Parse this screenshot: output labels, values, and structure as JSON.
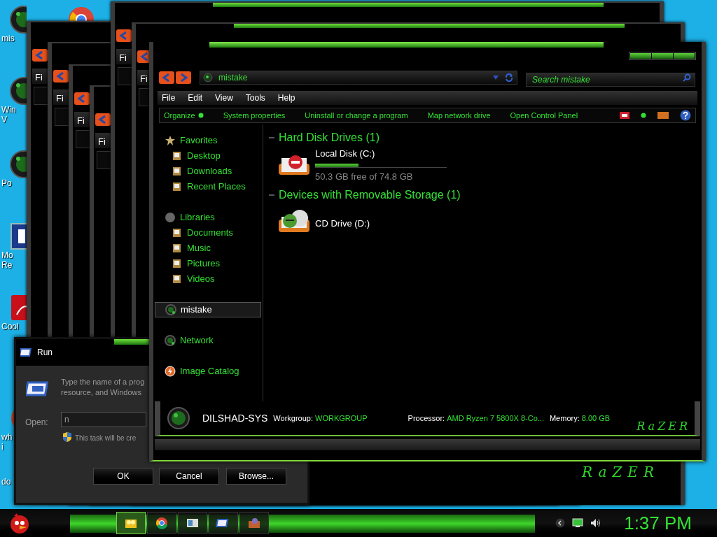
{
  "desktop_icons": [
    {
      "lines": [
        "mis"
      ]
    },
    {
      "lines": [
        "Win",
        "V"
      ]
    },
    {
      "lines": [
        "Po"
      ]
    },
    {
      "lines": [
        "Mo",
        "Re"
      ]
    },
    {
      "lines": [
        "Cool"
      ]
    },
    {
      "lines": [
        "wh",
        "i"
      ]
    },
    {
      "lines": [
        "do"
      ]
    }
  ],
  "background_windows": [
    {
      "menu_label": "Fi"
    },
    {
      "menu_label": "Fi"
    },
    {
      "menu_label": "Fi"
    },
    {
      "menu_label": "Fi"
    },
    {
      "menu_label": "Fi"
    },
    {
      "menu_label": "Fi",
      "logo": "RaZER"
    }
  ],
  "run_dialog": {
    "title": "Run",
    "description": [
      "Type the name of a prog",
      "resource, and Windows"
    ],
    "open_label": "Open:",
    "value": "n",
    "note": "This task will be cre",
    "buttons": [
      "OK",
      "Cancel",
      "Browse..."
    ]
  },
  "explorer": {
    "address": "mistake",
    "search": {
      "placeholder": "Search mistake"
    },
    "menu": [
      "File",
      "Edit",
      "View",
      "Tools",
      "Help"
    ],
    "toolbar": [
      {
        "label": "Organize",
        "dropdown": true
      },
      {
        "label": "System properties",
        "dropdown": false
      },
      {
        "label": "Uninstall or change a program",
        "dropdown": false
      },
      {
        "label": "Map network drive",
        "dropdown": false
      },
      {
        "label": "Open Control Panel",
        "dropdown": false
      }
    ],
    "sidebar": [
      {
        "label": "Favorites",
        "selected": false,
        "children": [
          {
            "label": "Desktop",
            "selected": false
          },
          {
            "label": "Downloads",
            "selected": false
          },
          {
            "label": "Recent Places",
            "selected": false
          }
        ]
      },
      {
        "label": "Libraries",
        "selected": false,
        "children": [
          {
            "label": "Documents",
            "selected": false
          },
          {
            "label": "Music",
            "selected": false
          },
          {
            "label": "Pictures",
            "selected": false
          },
          {
            "label": "Videos",
            "selected": false
          }
        ]
      },
      {
        "label": "mistake",
        "selected": true
      },
      {
        "label": "Network",
        "selected": false
      },
      {
        "label": "Image Catalog",
        "selected": false
      }
    ],
    "sections": [
      {
        "title": "Hard Disk Drives (1)",
        "drives": [
          {
            "kind": "disk",
            "name": "Local Disk (C:)",
            "level": 0.33,
            "reading": "50.3 GB free of 74.8 GB"
          }
        ]
      },
      {
        "title": "Devices with Removable Storage (1)",
        "drives": [
          {
            "kind": "cd",
            "name": "CD Drive (D:)"
          }
        ]
      }
    ],
    "details": {
      "computer_name": "DILSHAD-SYS",
      "fields": [
        {
          "label": "Workgroup:",
          "value": "WORKGROUP"
        },
        {
          "label": "Processor:",
          "value": "AMD Ryzen 7 5800X 8-Co..."
        },
        {
          "label": "Memory:",
          "value": "8.00 GB"
        }
      ],
      "logo": "RaZER"
    }
  },
  "taskbar": {
    "buttons": [
      {
        "selected": true
      },
      {
        "selected": false
      },
      {
        "selected": false
      },
      {
        "selected": false
      },
      {
        "selected": false
      }
    ],
    "clock": "1:37 PM"
  }
}
